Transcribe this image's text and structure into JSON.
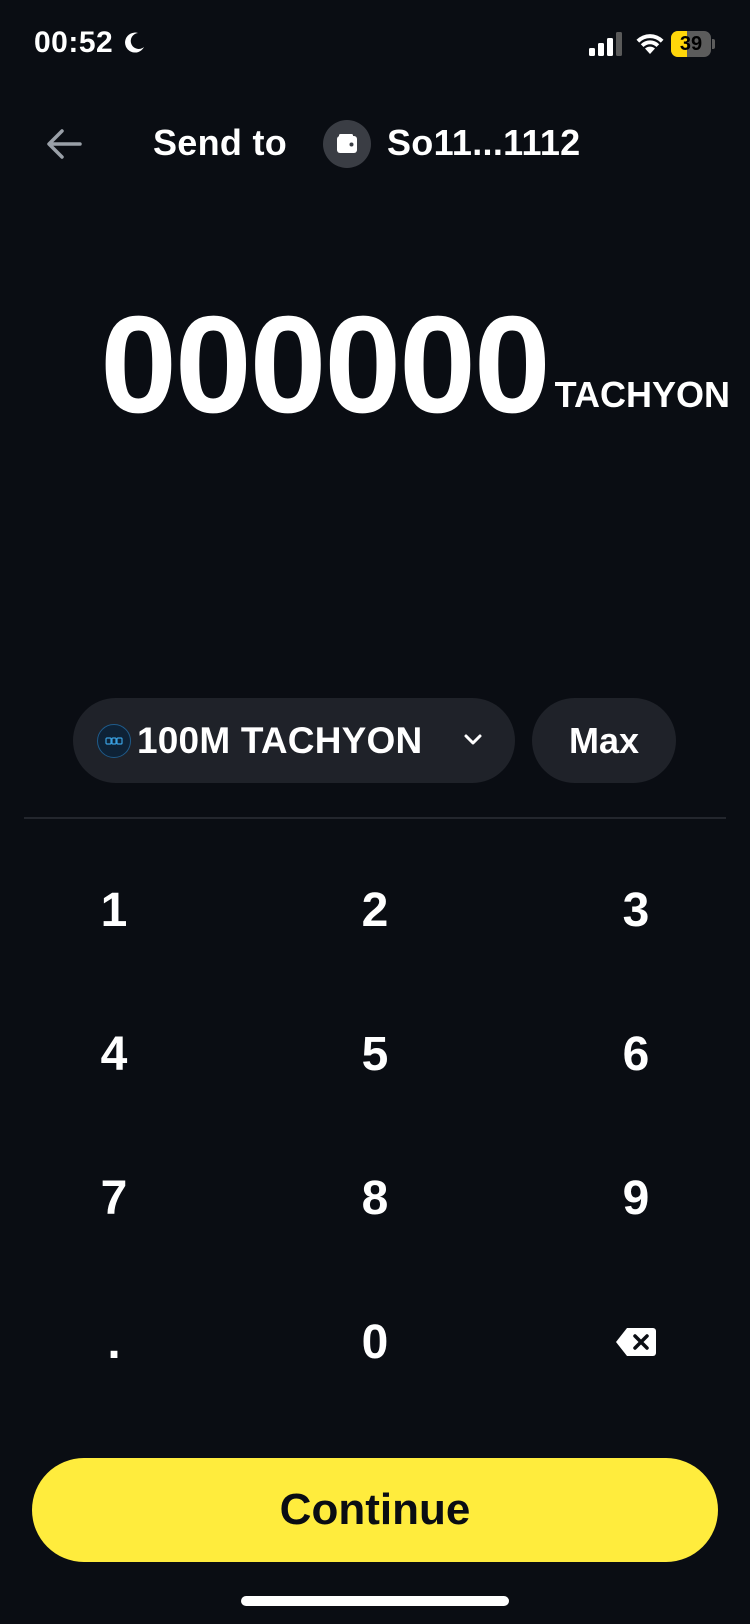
{
  "status_bar": {
    "time": "00:52",
    "battery_level": "39",
    "battery_fraction": 0.39,
    "battery_color": "#ffd60a"
  },
  "header": {
    "title": "Send to",
    "recipient": "So11...1112",
    "back_icon": "arrow-left-icon",
    "avatar_icon": "wallet-icon"
  },
  "amount": {
    "value": "000000",
    "unit": "TACHYON"
  },
  "token_selector": {
    "label": "100M TACHYON",
    "icon": "token-logo-icon"
  },
  "max_button": {
    "label": "Max"
  },
  "keypad": {
    "keys": [
      "1",
      "2",
      "3",
      "4",
      "5",
      "6",
      "7",
      "8",
      "9",
      ".",
      "0"
    ],
    "backspace_icon": "backspace-icon"
  },
  "continue_button": {
    "label": "Continue",
    "color": "#ffec3d"
  },
  "theme": {
    "background": "#0a0d13",
    "surface": "#1f2229"
  }
}
